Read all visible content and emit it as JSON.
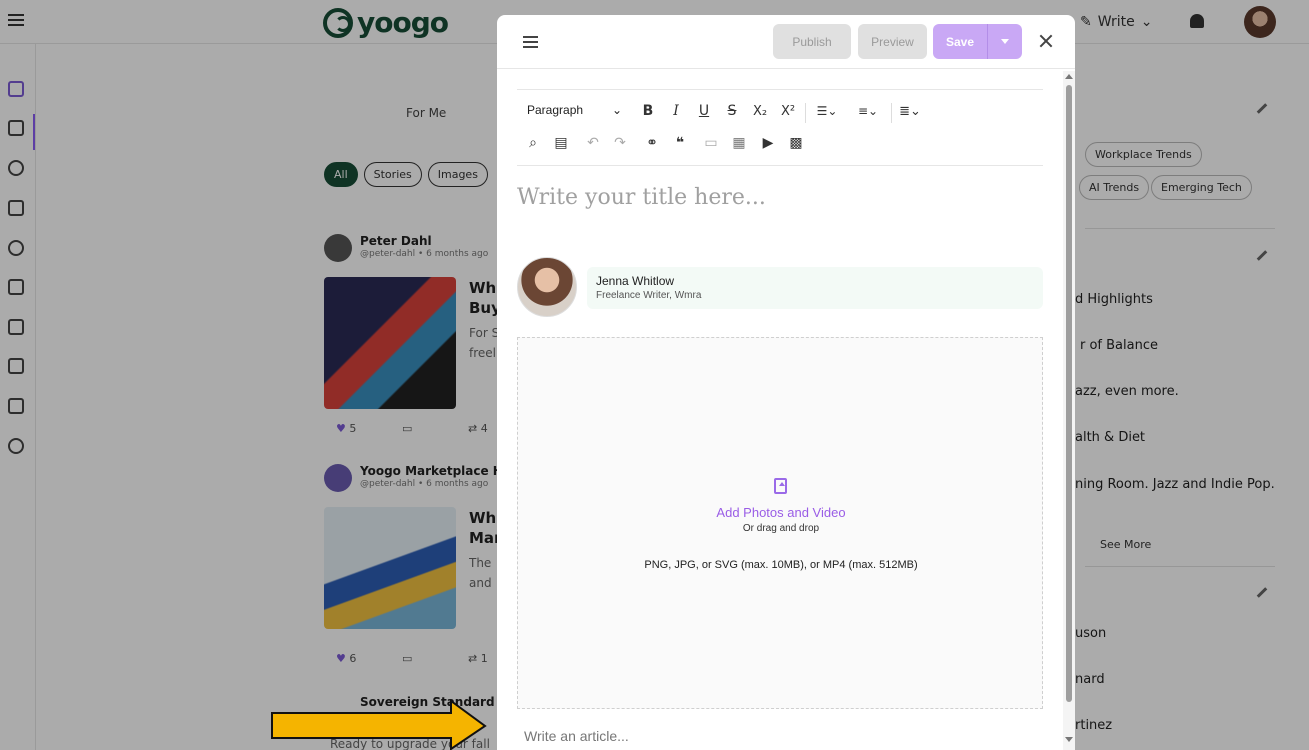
{
  "topbar": {
    "logo_text": "yoogo",
    "write_label": "Write"
  },
  "feed": {
    "tab_label": "For Me",
    "chips": [
      "All",
      "Stories",
      "Images"
    ],
    "posts": [
      {
        "author": "Peter Dahl",
        "handle": "@peter-dahl • 6 months ago",
        "title": "Wh",
        "title2": "Buy",
        "desc": "For S",
        "desc2": "freel",
        "likes": "5",
        "reposts": "4"
      },
      {
        "author": "Yoogo Marketplace Hu",
        "handle": "@peter-dahl • 6 months ago",
        "title": "Wh",
        "title2": "Mar",
        "desc": "The",
        "desc2": "and",
        "likes": "6",
        "reposts": "1"
      },
      {
        "author": "Sovereign Standard •",
        "desc": "Ready to upgrade your fall/winter palette?"
      }
    ]
  },
  "right": {
    "chips": [
      "Workplace Trends",
      "AI Trends",
      "Emerging Tech"
    ],
    "items": [
      "d Highlights",
      "r of Balance",
      "azz, even more.",
      "alth & Diet",
      "ning Room. Jazz and Indie Pop."
    ],
    "see_more": "See More",
    "names": [
      "uson",
      "nard",
      "rtinez"
    ]
  },
  "modal": {
    "publish": "Publish",
    "preview": "Preview",
    "save": "Save",
    "paragraph": "Paragraph",
    "title_placeholder": "Write your title here...",
    "author_name": "Jenna Whitlow",
    "author_role": "Freelance Writer, Wmra",
    "drop_title": "Add Photos and Video",
    "drop_sub": "Or drag and drop",
    "drop_formats": "PNG, JPG, or SVG (max. 10MB), or MP4 (max. 512MB)",
    "article_placeholder": "Write an article..."
  },
  "colors": {
    "accent": "#9a5de6",
    "save_button": "#c9a8f5",
    "brand": "#174d36",
    "arrow": "#f5b400"
  }
}
